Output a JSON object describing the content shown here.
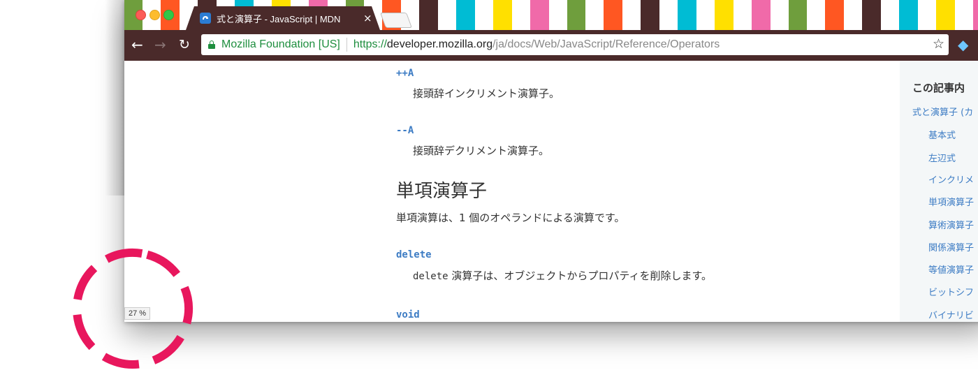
{
  "browser": {
    "tab": {
      "title": "式と演算子 - JavaScript | MDN",
      "close_glyph": "×"
    },
    "toolbar": {
      "back_glyph": "←",
      "forward_glyph": "→",
      "reload_glyph": "↻",
      "bookmark_glyph": "☆",
      "extension_glyph": "◆"
    },
    "omnibox": {
      "secure_label": "Mozilla Foundation [US]",
      "url_scheme": "https://",
      "url_host": "developer.mozilla.org",
      "url_path": "/ja/docs/Web/JavaScript/Reference/Operators"
    }
  },
  "article": {
    "entries": [
      {
        "term": "++A",
        "description": "接頭辞インクリメント演算子。"
      },
      {
        "term": "--A",
        "description": "接頭辞デクリメント演算子。"
      }
    ],
    "section_heading": "単項演算子",
    "section_intro": "単項演算は、1 個のオペランドによる演算です。",
    "unary_entries": [
      {
        "term": "delete",
        "code": "delete",
        "description": " 演算子は、オブジェクトからプロパティを削除します。"
      },
      {
        "term": "void"
      }
    ]
  },
  "toc": {
    "heading": "この記事内",
    "items": [
      "式と演算子 (カ",
      "基本式",
      "左辺式",
      "インクリメ",
      "単項演算子",
      "算術演算子",
      "関係演算子",
      "等値演算子",
      "ビットシフ",
      "バイナリビ"
    ]
  },
  "status": {
    "zoom": "27 %"
  },
  "colors": {
    "chrome": "#4a2a2a",
    "link": "#3d7cc4",
    "secure": "#1e8e3e",
    "spinner": "#e8175d"
  }
}
